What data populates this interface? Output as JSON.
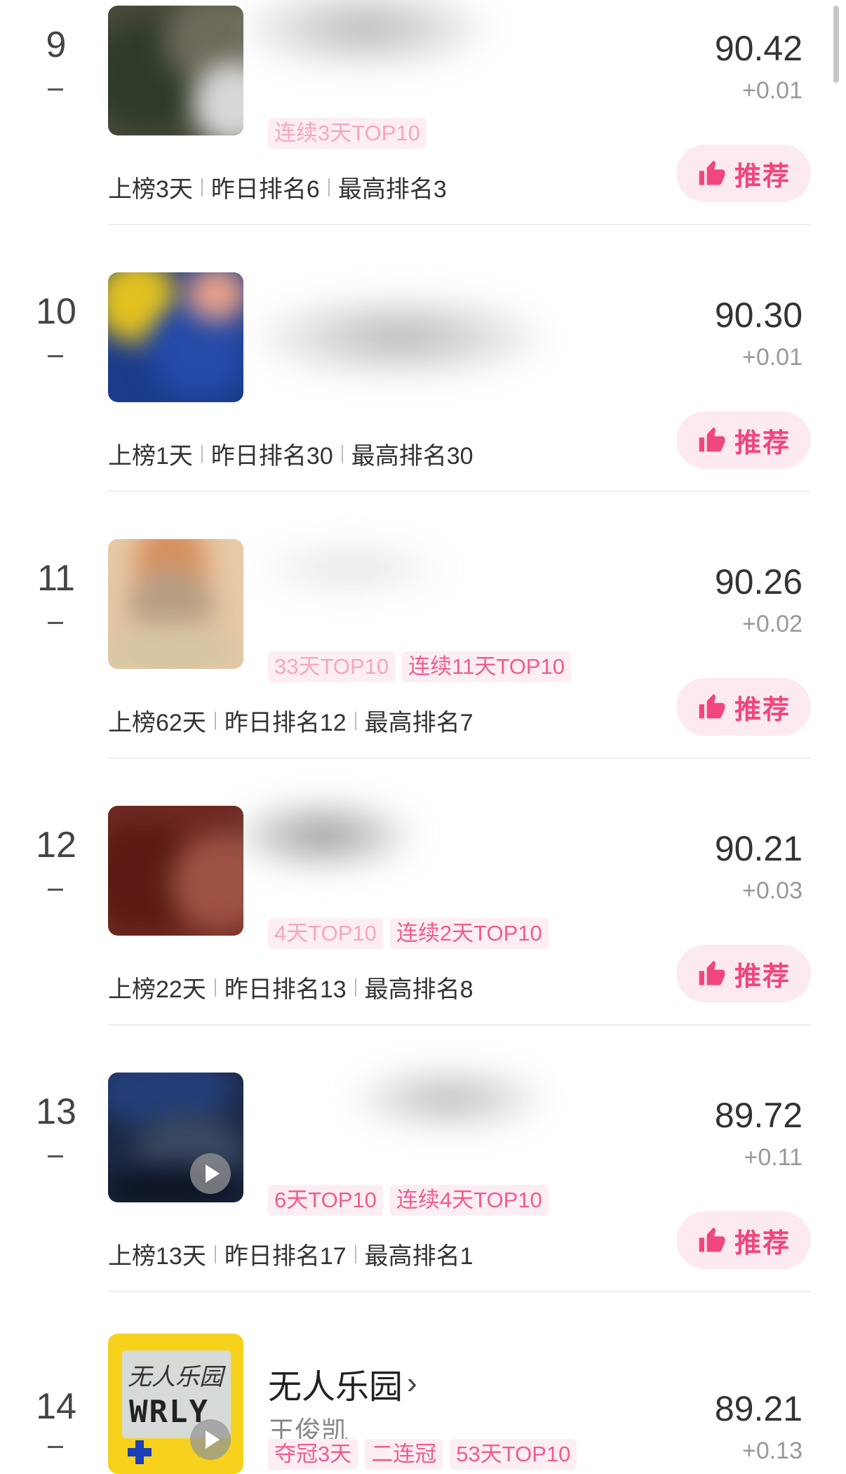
{
  "colors": {
    "accent": "#f0467e",
    "tag_bg": "#fdeef4",
    "tag_text": "#f05c8f",
    "button_bg": "#fdeaf1"
  },
  "recommend_label": "推荐",
  "entries": [
    {
      "rank": "9",
      "score": "90.42",
      "delta": "+0.01",
      "tags": [
        "连续3天TOP10"
      ],
      "stats": [
        "上榜3天",
        "昨日排名6",
        "最高排名3"
      ]
    },
    {
      "rank": "10",
      "score": "90.30",
      "delta": "+0.01",
      "tags": [],
      "stats": [
        "上榜1天",
        "昨日排名30",
        "最高排名30"
      ]
    },
    {
      "rank": "11",
      "score": "90.26",
      "delta": "+0.02",
      "tags": [
        "33天TOP10",
        "连续11天TOP10"
      ],
      "stats": [
        "上榜62天",
        "昨日排名12",
        "最高排名7"
      ]
    },
    {
      "rank": "12",
      "score": "90.21",
      "delta": "+0.03",
      "tags": [
        "4天TOP10",
        "连续2天TOP10"
      ],
      "stats": [
        "上榜22天",
        "昨日排名13",
        "最高排名8"
      ]
    },
    {
      "rank": "13",
      "score": "89.72",
      "delta": "+0.11",
      "tags": [
        "6天TOP10",
        "连续4天TOP10"
      ],
      "stats": [
        "上榜13天",
        "昨日排名17",
        "最高排名1"
      ]
    },
    {
      "rank": "14",
      "title": "无人乐园",
      "artist": "王俊凯",
      "score": "89.21",
      "delta": "+0.13",
      "tags": [
        "夺冠3天",
        "二连冠",
        "53天TOP10"
      ],
      "cover_title": "无人乐园",
      "cover_logo": "WRLY"
    }
  ]
}
